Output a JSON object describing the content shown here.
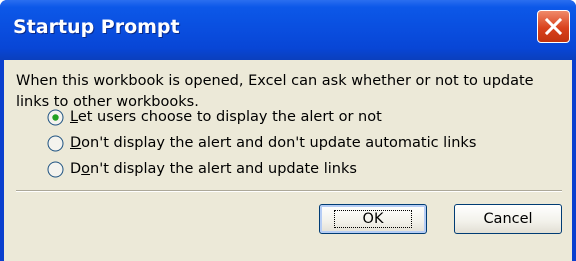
{
  "window": {
    "title": "Startup Prompt"
  },
  "dialog": {
    "message": "When this workbook is opened, Excel can ask whether or not to update links to other workbooks.",
    "options": [
      {
        "mnemonic": "L",
        "rest": "et users choose to display the alert or not",
        "selected": true
      },
      {
        "mnemonic": "D",
        "rest": "on't display the alert and don't update automatic links",
        "selected": false
      },
      {
        "pre": "D",
        "mnemonic": "o",
        "rest": "n't display the alert and update links",
        "selected": false
      }
    ]
  },
  "buttons": {
    "ok_label": "OK",
    "cancel_label": "Cancel"
  },
  "colors": {
    "titlebar": "#0a4fe0",
    "close": "#d9421c",
    "dialog_bg": "#ece9d8",
    "button_border": "#003c74"
  },
  "icons": {
    "close": "close-icon",
    "radio_selected": "radio-selected-icon",
    "radio_unselected": "radio-unselected-icon"
  }
}
